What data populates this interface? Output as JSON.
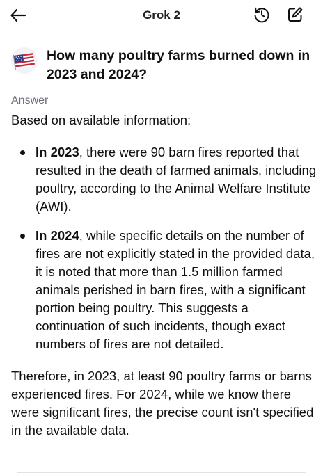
{
  "header": {
    "title": "Grok 2"
  },
  "question": {
    "text": "How many poultry farms burned down in 2023 and 2024?"
  },
  "answer": {
    "label": "Answer",
    "intro": "Based on available information:",
    "bullets": [
      {
        "lead": "In 2023",
        "text": ", there were 90 barn fires reported that resulted in the death of farmed animals, including poultry, according to the Animal Welfare Institute (AWI)."
      },
      {
        "lead": "In 2024",
        "text": ", while specific details on the number of fires are not explicitly stated in the provided data, it is noted that more than 1.5 million farmed animals perished in barn fires, with a significant portion being poultry. This suggests a continuation of such incidents, though exact numbers of fires are not detailed."
      }
    ],
    "conclusion": "Therefore, in 2023, at least 90 poultry farms or barns experienced fires. For 2024, while we know there were significant fires, the precise count isn't specified in the available data."
  },
  "icons": {
    "back": "arrow-left-icon",
    "history": "history-icon",
    "compose": "compose-icon",
    "avatar": "us-flag-icon"
  },
  "colors": {
    "text": "#111111",
    "muted": "#6b6f78",
    "background": "#ffffff"
  }
}
